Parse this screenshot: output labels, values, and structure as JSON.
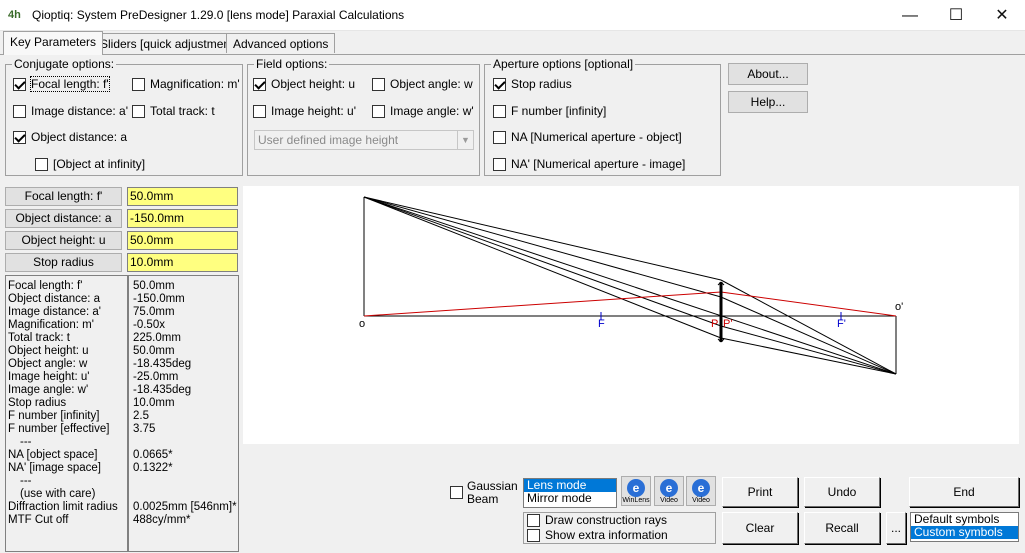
{
  "window": {
    "icon_text": "4h",
    "title": "Qioptiq: System PreDesigner 1.29.0    [lens mode]   Paraxial Calculations",
    "minimize": "—",
    "maximize": "☐",
    "close": "✕"
  },
  "tabs": [
    {
      "label": "Key Parameters"
    },
    {
      "label": "Sliders [quick adjustment]"
    },
    {
      "label": "Advanced options"
    }
  ],
  "conjugate": {
    "legend": "Conjugate options:",
    "focal": "Focal length: f'",
    "magnification": "Magnification: m'",
    "image_distance": "Image distance: a'",
    "total_track": "Total track: t",
    "object_distance": "Object distance: a",
    "object_infinity": "[Object at infinity]"
  },
  "field": {
    "legend": "Field options:",
    "object_height": "Object height: u",
    "object_angle": "Object angle: w",
    "image_height": "Image height: u'",
    "image_angle": "Image angle: w'",
    "dropdown": "User defined image height"
  },
  "aperture": {
    "legend": "Aperture options [optional]",
    "stop_radius": "Stop radius",
    "f_number": "F number [infinity]",
    "na_object": "NA [Numerical aperture - object]",
    "na_image": "NA' [Numerical aperture - image]"
  },
  "buttons": {
    "about": "About...",
    "help": "Help...",
    "print": "Print",
    "undo": "Undo",
    "end": "End",
    "clear": "Clear",
    "recall": "Recall",
    "more": "..."
  },
  "params": [
    {
      "label": "Focal length: f'",
      "value": "50.0mm"
    },
    {
      "label": "Object distance: a",
      "value": "-150.0mm"
    },
    {
      "label": "Object height: u",
      "value": "50.0mm"
    },
    {
      "label": "Stop radius",
      "value": "10.0mm"
    }
  ],
  "readout": {
    "labels": [
      "Focal length: f'",
      "Object distance: a",
      "Image distance: a'",
      "Magnification: m'",
      "Total track: t",
      "Object height: u",
      "Object angle: w",
      "Image height: u'",
      "Image angle: w'",
      "Stop radius",
      "F number [infinity]",
      "F number [effective]",
      "---",
      "NA [object space]",
      "NA' [image space]",
      "---",
      "(use with care)",
      "Diffraction limit radius",
      "MTF Cut off"
    ],
    "values": [
      "50.0mm",
      "-150.0mm",
      "75.0mm",
      "-0.50x",
      "225.0mm",
      "50.0mm",
      "-18.435deg",
      "-25.0mm",
      "-18.435deg",
      "10.0mm",
      "2.5",
      "3.75",
      "",
      "0.0665*",
      "0.1322*",
      "",
      "",
      "0.0025mm [546nm]*",
      "488cy/mm*"
    ]
  },
  "diagram": {
    "label_o": "o",
    "label_o_prime": "o'",
    "label_f": "F",
    "label_p": "P",
    "label_p_prime": "P'",
    "label_f_prime": "F'",
    "ray_color": "#000000",
    "marginal_color": "#cc0000",
    "focal_color": "#0000cc"
  },
  "bottom": {
    "gaussian_line1": "Gaussian",
    "gaussian_line2": "Beam",
    "modes": [
      "Lens mode",
      "Mirror mode"
    ],
    "draw_rays": "Draw construction rays",
    "show_info": "Show extra information",
    "icon1_caption": "WinLens",
    "icon2_caption": "Video",
    "icon3_caption": "Video",
    "symbols": [
      "Default symbols",
      "Custom symbols"
    ]
  }
}
